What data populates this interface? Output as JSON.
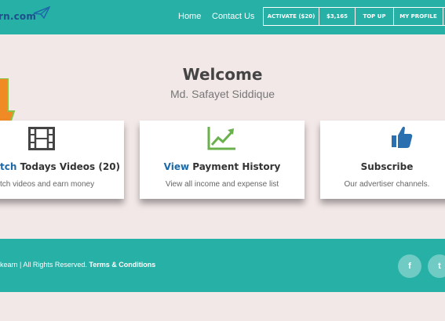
{
  "header": {
    "logo_text": "rn.com",
    "nav_links": [
      "Home",
      "Contact Us"
    ],
    "buttons": [
      "ACTIVATE ($20)",
      "$3,165",
      "TOP UP",
      "MY PROFILE"
    ]
  },
  "welcome": {
    "title": "Welcome",
    "name": "Md. Safayet Siddique"
  },
  "cards": [
    {
      "title_highlight": "tch",
      "title_rest": " Todays Videos (20)",
      "desc": "tch videos and earn money",
      "icon": "film-icon"
    },
    {
      "title_highlight": "View",
      "title_rest": " Payment History",
      "desc": "View all income and expense list",
      "icon": "chart-trend-icon"
    },
    {
      "title_highlight": "",
      "title_rest": "Subscribe",
      "desc": "Our advertiser channels.",
      "icon": "thumbs-up-icon"
    }
  ],
  "footer": {
    "copyright": "kearn | All Rights Reserved.",
    "terms": "Terms & Conditions",
    "social": [
      "f",
      "t"
    ]
  },
  "colors": {
    "header_bg": "#26b0a6",
    "page_bg": "#f3e8e8",
    "link_blue": "#1d69a8",
    "arrow_orange": "#f08a24",
    "arrow_green": "#8bc34a",
    "chart_green": "#6ab04c",
    "thumb_blue": "#2a6fb0"
  }
}
